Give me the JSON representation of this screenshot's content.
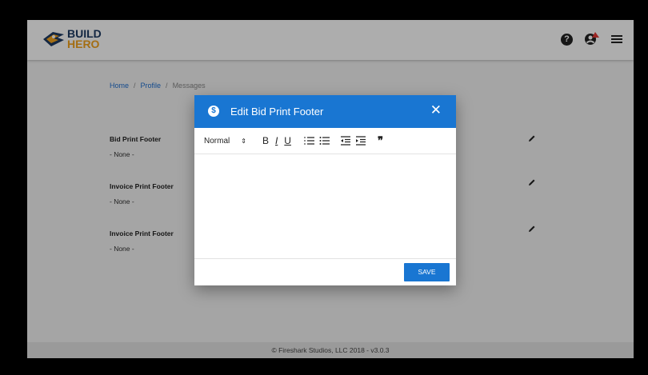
{
  "brand": {
    "line1": "BUILD",
    "line2": "HERO"
  },
  "header": {
    "help_glyph": "?",
    "icons": [
      "help-icon",
      "account-icon",
      "menu-icon"
    ]
  },
  "breadcrumb": {
    "items": [
      "Home",
      "Profile",
      "Messages"
    ],
    "separator": "/"
  },
  "fields": [
    {
      "label": "Bid Print Footer",
      "value": "- None -"
    },
    {
      "label": "Invoice Print Footer",
      "value": "- None -"
    },
    {
      "label": "Invoice Print Footer",
      "value": "- None -"
    }
  ],
  "footer": {
    "text": "© Fireshark Studios, LLC 2018 - v3.0.3"
  },
  "modal": {
    "title": "Edit Bid Print Footer",
    "title_icon_glyph": "$",
    "close_glyph": "✕",
    "editor_size": "Normal",
    "toolbar_glyphs": {
      "bold": "B",
      "italic": "I",
      "underline": "U",
      "quote": "❞"
    },
    "editor_value": "",
    "save_label": "SAVE"
  },
  "colors": {
    "primary": "#1976d2",
    "brand_blue": "#1d3a64",
    "brand_orange": "#f2a21c"
  }
}
